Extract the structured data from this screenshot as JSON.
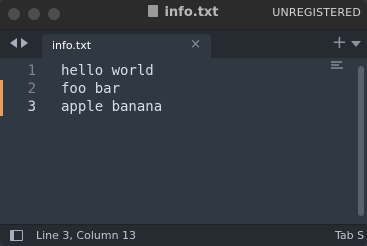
{
  "window": {
    "title": "info.txt",
    "registration_status": "UNREGISTERED"
  },
  "tabs": [
    {
      "label": "info.txt",
      "close_glyph": "×"
    }
  ],
  "tabbar": {
    "new_tab_glyph": "+"
  },
  "editor": {
    "lines": [
      {
        "number": "1",
        "text": "hello world",
        "modified": false,
        "current": false
      },
      {
        "number": "2",
        "text": "foo bar",
        "modified": true,
        "current": false
      },
      {
        "number": "3",
        "text": "apple banana",
        "modified": true,
        "current": true
      }
    ]
  },
  "statusbar": {
    "position": "Line 3, Column 13",
    "tab_size": "Tab S"
  },
  "colors": {
    "editor_bg": "#303841",
    "tabbar_bg": "#262b31",
    "modified_marker": "#f29b4a",
    "text": "#d8dee9"
  },
  "icons": [
    "back-arrow-icon",
    "forward-arrow-icon",
    "file-icon",
    "close-icon",
    "plus-icon",
    "chevron-down-icon",
    "panel-toggle-icon"
  ]
}
